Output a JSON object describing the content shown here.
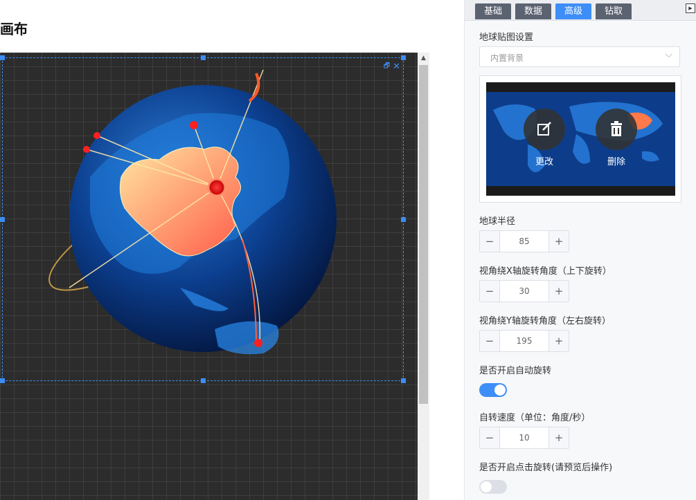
{
  "canvas": {
    "title": "画布"
  },
  "tabs": [
    {
      "label": "基础",
      "active": false
    },
    {
      "label": "数据",
      "active": false
    },
    {
      "label": "高级",
      "active": true
    },
    {
      "label": "钻取",
      "active": false
    }
  ],
  "settings": {
    "texture_label": "地球贴图设置",
    "texture_select_value": "内置背景",
    "preview_change_label": "更改",
    "preview_delete_label": "删除",
    "radius_label": "地球半径",
    "radius_value": "85",
    "x_angle_label": "视角绕X轴旋转角度（上下旋转）",
    "x_angle_value": "30",
    "y_angle_label": "视角绕Y轴旋转角度（左右旋转）",
    "y_angle_value": "195",
    "auto_rotate_label": "是否开启自动旋转",
    "auto_rotate_on": true,
    "speed_label": "自转速度（单位：角度/秒）",
    "speed_value": "10",
    "click_rotate_label": "是否开启点击旋转(请预览后操作)",
    "click_rotate_on": false
  },
  "colors": {
    "accent": "#3e8ef7",
    "tab_inactive": "#5b6270",
    "canvas_bg": "#2c2c2c",
    "globe_ocean": "#0b3a86",
    "china_fill": "#ff8a5a"
  },
  "icons": {
    "stepper_minus": "−",
    "stepper_plus": "+",
    "select_chevron": "⌵",
    "collapse": "▶",
    "restore": "🗗",
    "close": "✕"
  }
}
